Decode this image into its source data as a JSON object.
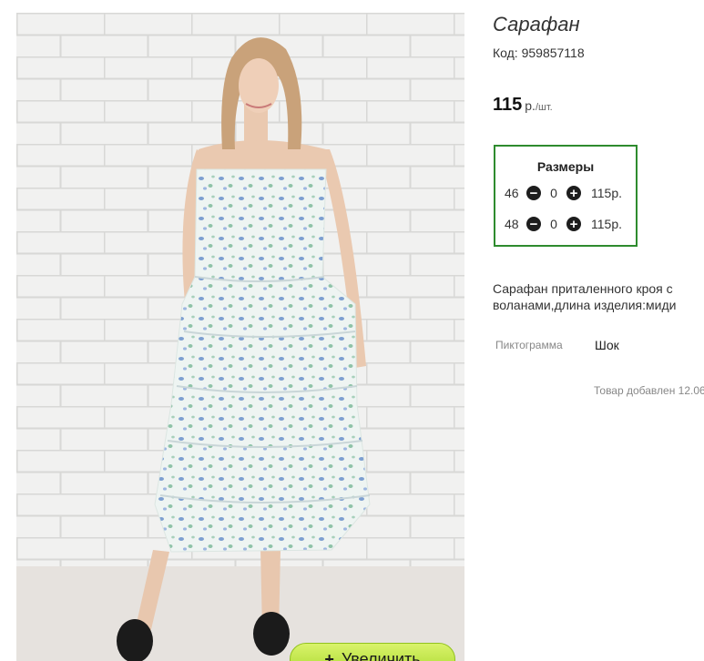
{
  "product": {
    "title": "Сарафан",
    "code": "Код: 959857118",
    "price": "115",
    "price_unit": "р.",
    "price_per": "/шт.",
    "description": "Сарафан приталенного кроя с воланами,длина изделия:миди",
    "property_label": "Пиктограмма",
    "property_value": "Шок",
    "added": "Товар добавлен 12.06"
  },
  "sizes": {
    "title": "Размеры",
    "rows": [
      {
        "size": "46",
        "quantity": "0",
        "price": "115р."
      },
      {
        "size": "48",
        "quantity": "0",
        "price": "115р."
      }
    ]
  },
  "zoom_button": {
    "label": "Увеличить",
    "icon": "plus-icon"
  },
  "icons": {
    "minus": "minus-icon",
    "plus": "plus-icon"
  },
  "colors": {
    "sizes_border": "#2e8b2e",
    "zoom_button": "#b7e23c"
  }
}
